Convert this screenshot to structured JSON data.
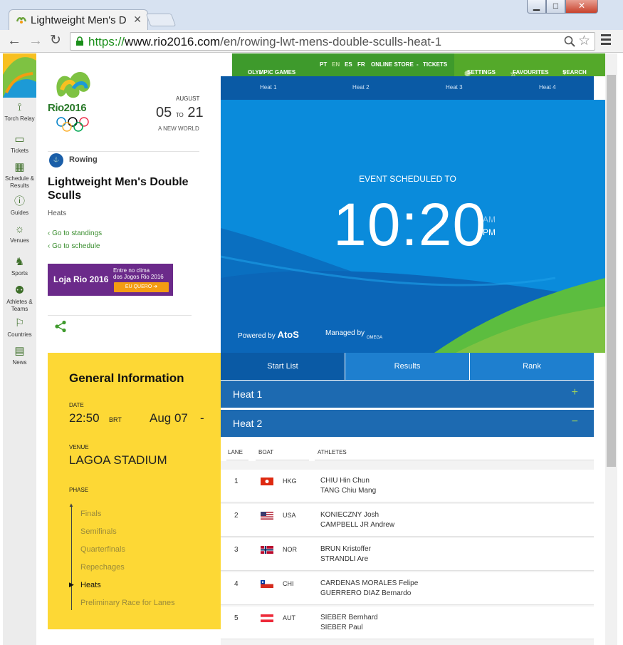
{
  "browser": {
    "tab_title": "Lightweight Men's D",
    "url_https": "https://",
    "url_host": "www.rio2016.com",
    "url_path": "/en/rowing-lwt-mens-double-sculls-heat-1"
  },
  "sidenav": [
    {
      "label": "Torch Relay",
      "icon": "torch-icon"
    },
    {
      "label": "Tickets",
      "icon": "ticket-icon"
    },
    {
      "label": "Schedule & Results",
      "icon": "calendar-icon"
    },
    {
      "label": "Guides",
      "icon": "info-icon"
    },
    {
      "label": "Venues",
      "icon": "venue-icon"
    },
    {
      "label": "Sports",
      "icon": "runner-icon"
    },
    {
      "label": "Athletes & Teams",
      "icon": "athletes-icon"
    },
    {
      "label": "Countries",
      "icon": "flag-icon"
    },
    {
      "label": "News",
      "icon": "news-icon"
    }
  ],
  "brand": {
    "logo_text": "Rio2016",
    "month": "AUGUST",
    "date_from": "05",
    "date_to_word": "TO",
    "date_to": "21",
    "slogan": "A NEW WORLD"
  },
  "event": {
    "sport": "Rowing",
    "title": "Lightweight Men's Double Sculls",
    "stage": "Heats",
    "link_standings": "Go to standings",
    "link_schedule": "Go to schedule"
  },
  "banner": {
    "brand": "Loja Rio 2016",
    "line1": "Entre no clima",
    "line2": "dos Jogos Rio 2016",
    "cta": "EU QUERO"
  },
  "topbar": {
    "olympic_games": "OLYMPIC GAMES",
    "langs": [
      "PT",
      "EN",
      "ES",
      "FR"
    ],
    "online_store": "ONLINE STORE",
    "separator": "-",
    "tickets": "TICKETS",
    "settings": "SETTINGS",
    "favourites": "FAVOURITES",
    "search": "SEARCH"
  },
  "heat_tabs": [
    "Heat 1",
    "Heat 2",
    "Heat 3",
    "Heat 4"
  ],
  "hero": {
    "scheduled_label": "EVENT SCHEDULED TO",
    "time": "10:20",
    "am": "AM",
    "pm": "PM",
    "powered_by": "Powered by",
    "powered_brand": "AtoS",
    "managed_by": "Managed by",
    "managed_brand": "OMEGA"
  },
  "general": {
    "heading": "General Information",
    "date_label": "DATE",
    "time": "22:50",
    "tz": "BRT",
    "date": "Aug 07",
    "dash": "-",
    "venue_label": "VENUE",
    "venue": "LAGOA STADIUM",
    "phase_label": "PHASE",
    "phases": [
      "Finals",
      "Semifinals",
      "Quarterfinals",
      "Repechages",
      "Heats",
      "Preliminary Race for Lanes"
    ]
  },
  "result_tabs": [
    "Start List",
    "Results",
    "Rank"
  ],
  "heats": [
    {
      "label": "Heat 1",
      "sign": "+"
    },
    {
      "label": "Heat 2",
      "sign": "−"
    }
  ],
  "startlist": {
    "col_lane": "LANE",
    "col_boat": "BOAT",
    "col_athletes": "ATHLETES",
    "rows": [
      {
        "lane": "1",
        "code": "HKG",
        "athletes": [
          "CHIU Hin Chun",
          "TANG Chiu Mang"
        ]
      },
      {
        "lane": "2",
        "code": "USA",
        "athletes": [
          "KONIECZNY Josh",
          "CAMPBELL JR Andrew"
        ]
      },
      {
        "lane": "3",
        "code": "NOR",
        "athletes": [
          "BRUN Kristoffer",
          "STRANDLI Are"
        ]
      },
      {
        "lane": "4",
        "code": "CHI",
        "athletes": [
          "CARDENAS MORALES Felipe",
          "GUERRERO DIAZ Bernardo"
        ]
      },
      {
        "lane": "5",
        "code": "AUT",
        "athletes": [
          "SIEBER Bernhard",
          "SIEBER Paul"
        ]
      }
    ]
  },
  "colors": {
    "green": "#54a92a",
    "blue": "#0a8bdb",
    "navy": "#0a5aa5",
    "yellow": "#fdd835"
  }
}
